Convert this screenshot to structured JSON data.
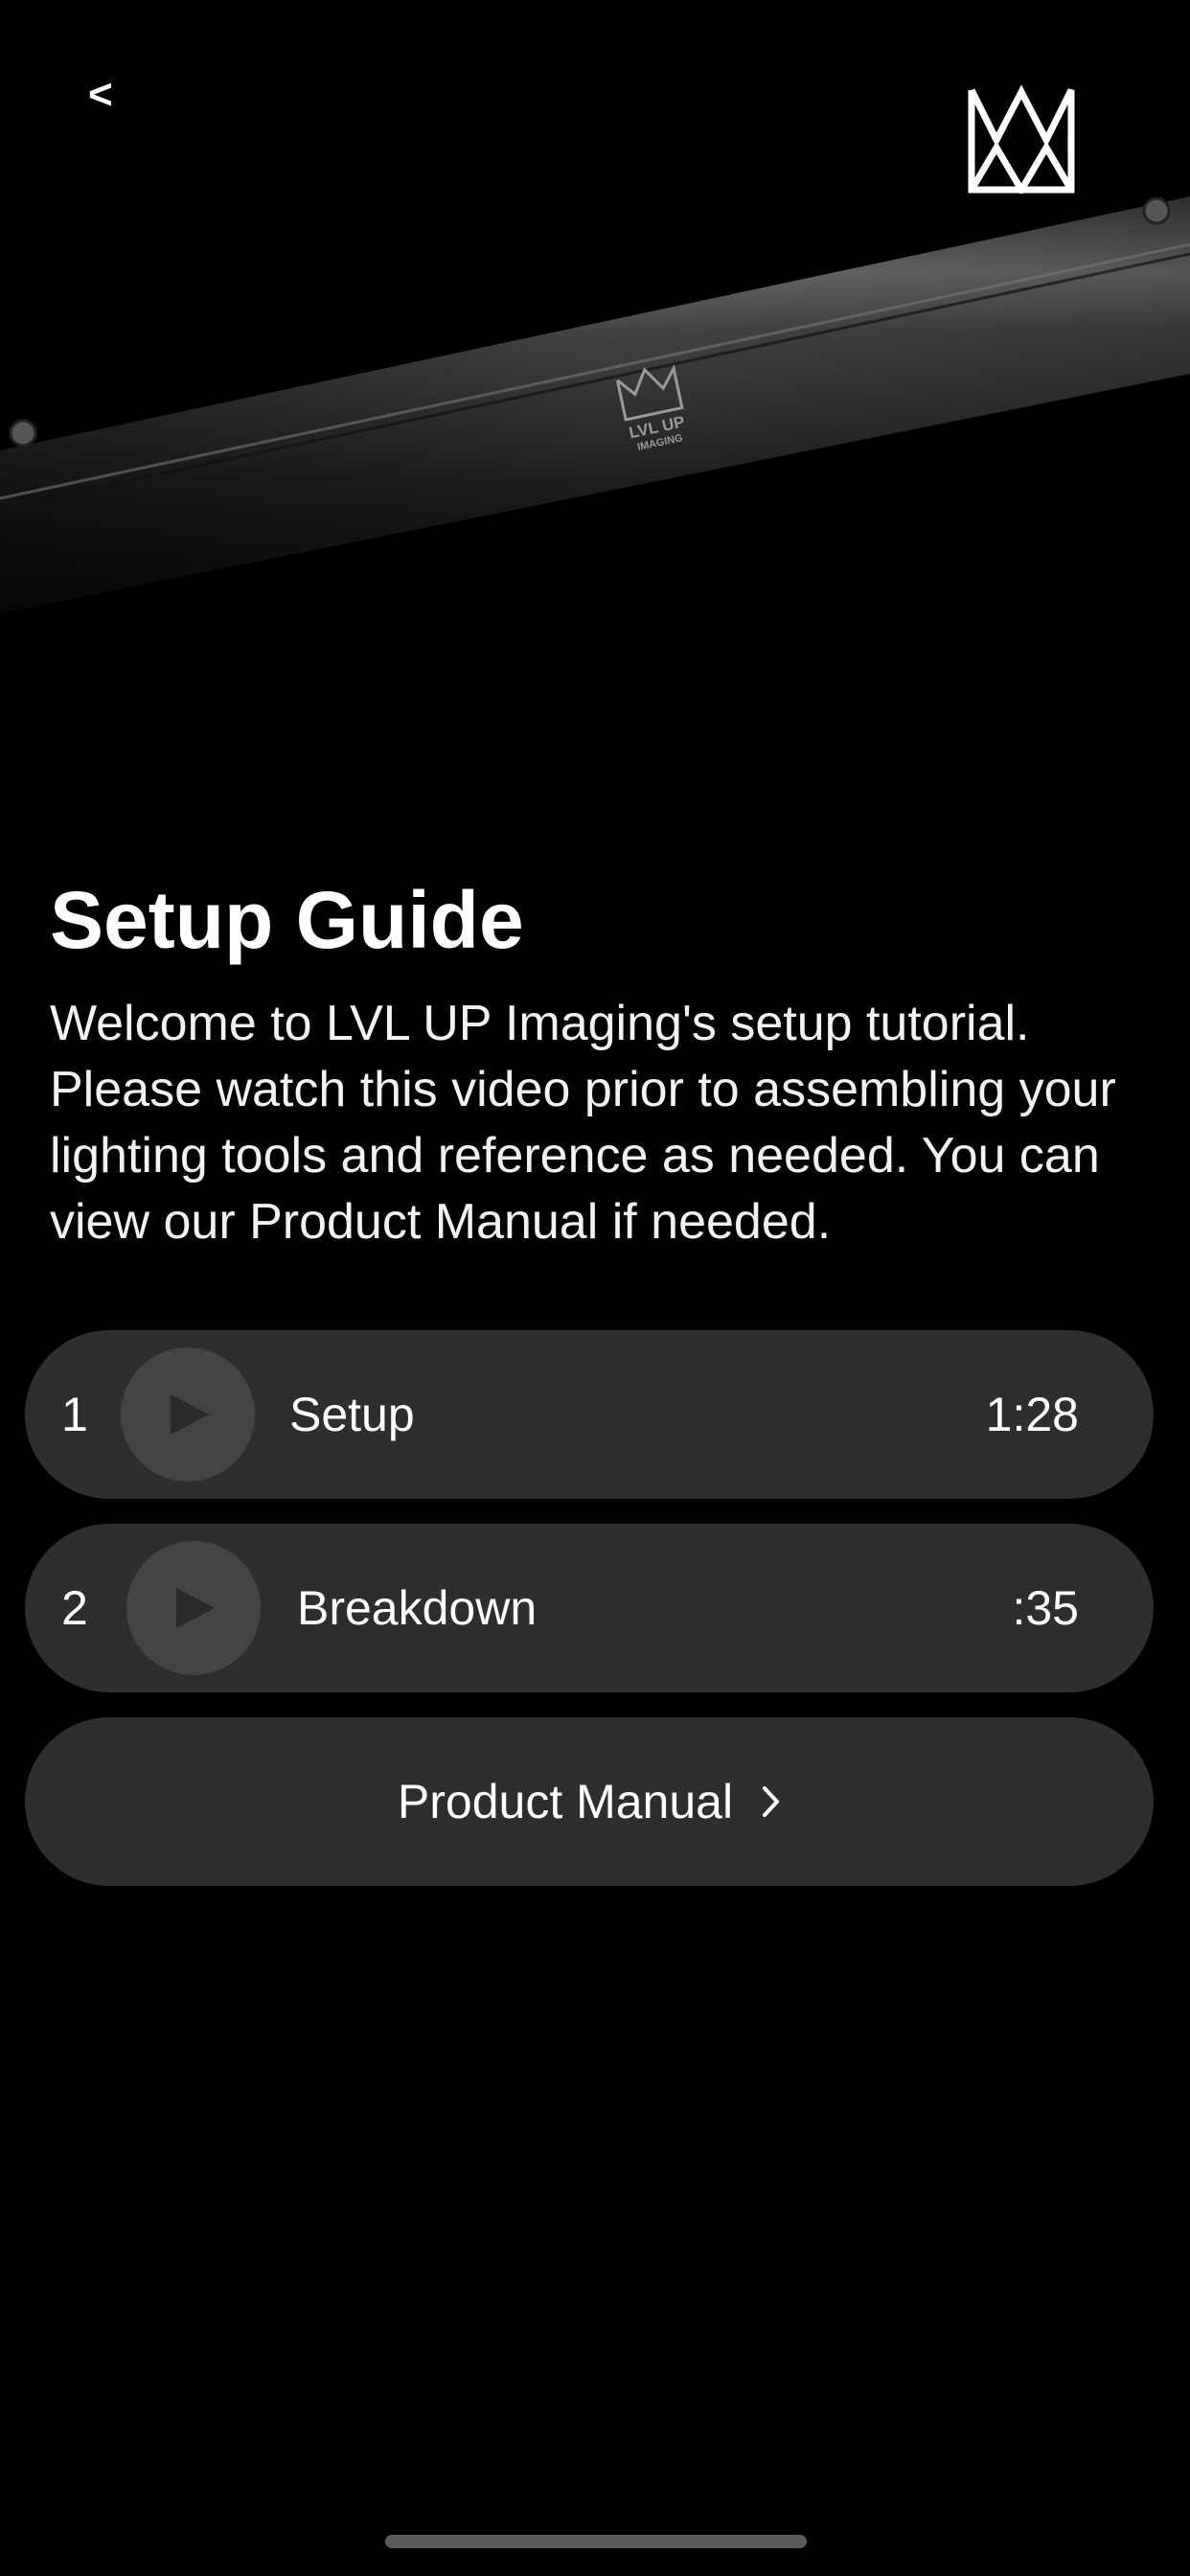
{
  "header": {
    "back_label": "<"
  },
  "hero": {
    "logo_text_line1": "LVL UP",
    "logo_text_line2": "IMAGING"
  },
  "page": {
    "title": "Setup Guide",
    "description": "Welcome to LVL UP Imaging's setup tutorial. Please watch this video prior to assembling your lighting tools and reference as needed. You can view our Product Manual if needed."
  },
  "videos": [
    {
      "number": "1",
      "label": "Setup",
      "duration": "1:28"
    },
    {
      "number": "2",
      "label": "Breakdown",
      "duration": ":35"
    }
  ],
  "manual": {
    "label": "Product Manual"
  },
  "icons": {
    "back": "chevron-left-icon",
    "logo": "crown-logo-icon",
    "play": "play-icon",
    "manual_arrow": "chevron-right-icon"
  },
  "colors": {
    "background": "#000000",
    "row_background": "#2e2e2e",
    "play_circle": "#444444",
    "text": "#ffffff"
  }
}
